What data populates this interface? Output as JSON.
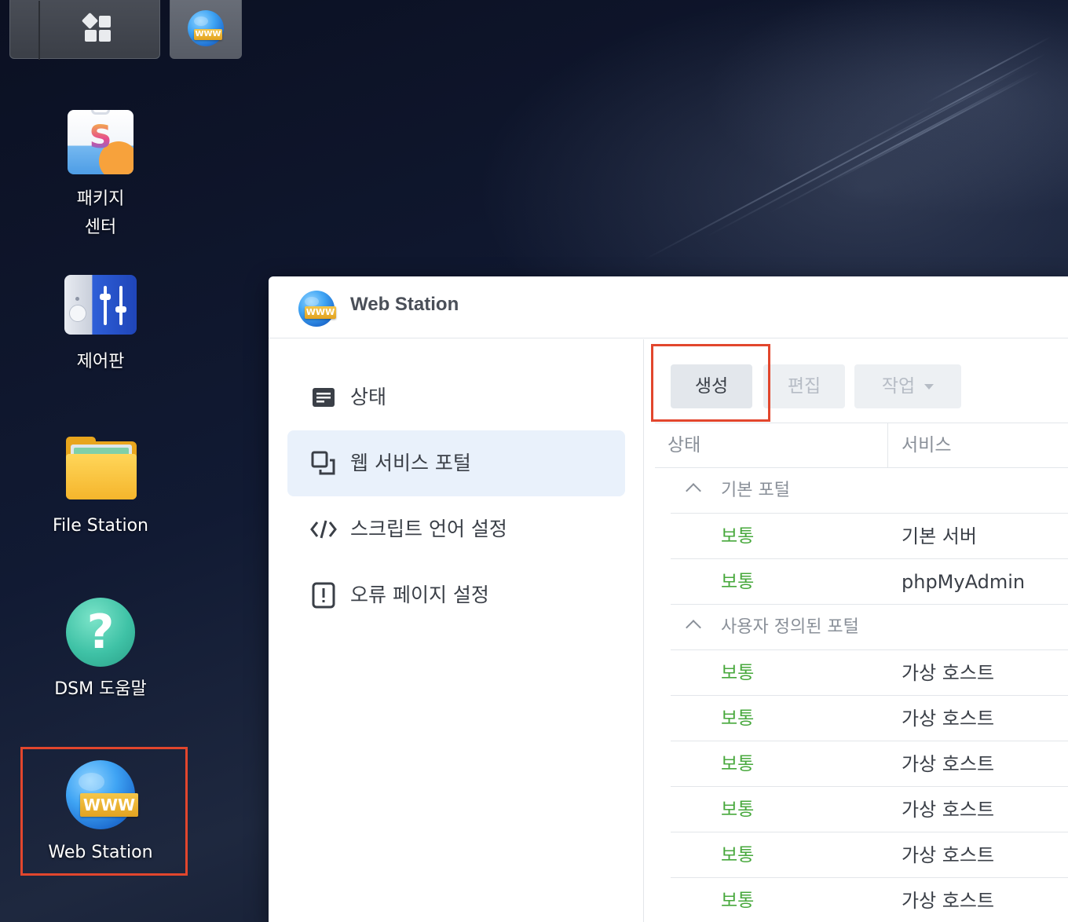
{
  "desktop": {
    "icons": [
      {
        "label_line1": "패키지",
        "label_line2": "센터"
      },
      {
        "label": "제어판"
      },
      {
        "label": "File Station"
      },
      {
        "label": "DSM 도움말"
      },
      {
        "label": "Web Station"
      }
    ],
    "www_badge": "WWW"
  },
  "window": {
    "title": "Web Station",
    "sidebar": {
      "items": [
        {
          "label": "상태",
          "icon": "document-icon"
        },
        {
          "label": "웹 서비스 포털",
          "icon": "portal-icon"
        },
        {
          "label": "스크립트 언어 설정",
          "icon": "code-icon"
        },
        {
          "label": "오류 페이지 설정",
          "icon": "error-page-icon"
        }
      ],
      "active_index": 1
    },
    "toolbar": {
      "create_label": "생성",
      "edit_label": "편집",
      "action_label": "작업"
    },
    "table": {
      "columns": [
        "상태",
        "서비스"
      ],
      "groups": [
        {
          "label": "기본 포털",
          "rows": [
            {
              "status": "보통",
              "service": "기본 서버"
            },
            {
              "status": "보통",
              "service": "phpMyAdmin"
            }
          ]
        },
        {
          "label": "사용자 정의된 포털",
          "rows": [
            {
              "status": "보통",
              "service": "가상 호스트"
            },
            {
              "status": "보통",
              "service": "가상 호스트"
            },
            {
              "status": "보통",
              "service": "가상 호스트"
            },
            {
              "status": "보통",
              "service": "가상 호스트"
            },
            {
              "status": "보통",
              "service": "가상 호스트"
            },
            {
              "status": "보통",
              "service": "가상 호스트"
            }
          ]
        }
      ]
    },
    "colors": {
      "status_ok": "#47a83c",
      "highlight": "#e2462d",
      "active_nav": "#e9f1fb"
    }
  }
}
